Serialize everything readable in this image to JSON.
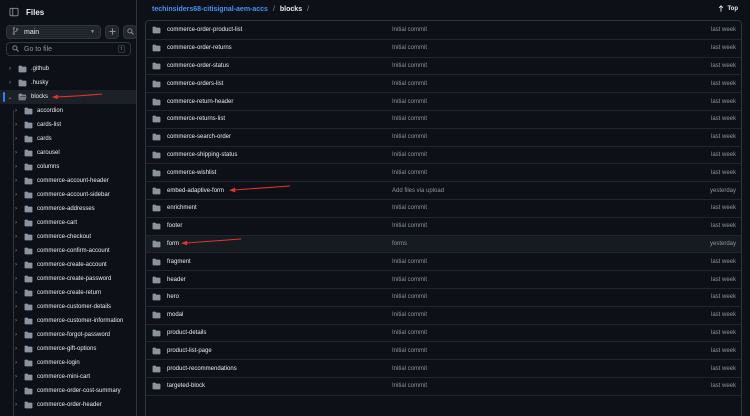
{
  "sidebar": {
    "title": "Files",
    "branch": "main",
    "goto_placeholder": "Go to file",
    "goto_shortcut": "t",
    "tree": [
      {
        "label": ".github",
        "indent": 0
      },
      {
        "label": ".husky",
        "indent": 0
      },
      {
        "label": "blocks",
        "indent": 0,
        "expanded": true,
        "selected": true
      },
      {
        "label": "accordion",
        "indent": 1
      },
      {
        "label": "cards-list",
        "indent": 1
      },
      {
        "label": "cards",
        "indent": 1
      },
      {
        "label": "carousel",
        "indent": 1
      },
      {
        "label": "columns",
        "indent": 1
      },
      {
        "label": "commerce-account-header",
        "indent": 1
      },
      {
        "label": "commerce-account-sidebar",
        "indent": 1
      },
      {
        "label": "commerce-addresses",
        "indent": 1
      },
      {
        "label": "commerce-cart",
        "indent": 1
      },
      {
        "label": "commerce-checkout",
        "indent": 1
      },
      {
        "label": "commerce-confirm-account",
        "indent": 1
      },
      {
        "label": "commerce-create-account",
        "indent": 1
      },
      {
        "label": "commerce-create-password",
        "indent": 1
      },
      {
        "label": "commerce-create-return",
        "indent": 1
      },
      {
        "label": "commerce-customer-details",
        "indent": 1
      },
      {
        "label": "commerce-customer-information",
        "indent": 1
      },
      {
        "label": "commerce-forgot-password",
        "indent": 1
      },
      {
        "label": "commerce-gift-options",
        "indent": 1
      },
      {
        "label": "commerce-login",
        "indent": 1
      },
      {
        "label": "commerce-mini-cart",
        "indent": 1
      },
      {
        "label": "commerce-order-cost-summary",
        "indent": 1
      },
      {
        "label": "commerce-order-header",
        "indent": 1
      }
    ]
  },
  "header": {
    "repo": "techinsiders68-citisignal-aem-accs",
    "separator": "/",
    "current": "blocks",
    "top_label": "Top"
  },
  "files": [
    {
      "name": "commerce-order-product-list",
      "message": "Initial commit",
      "date": "last week"
    },
    {
      "name": "commerce-order-returns",
      "message": "Initial commit",
      "date": "last week"
    },
    {
      "name": "commerce-order-status",
      "message": "Initial commit",
      "date": "last week"
    },
    {
      "name": "commerce-orders-list",
      "message": "Initial commit",
      "date": "last week"
    },
    {
      "name": "commerce-return-header",
      "message": "Initial commit",
      "date": "last week"
    },
    {
      "name": "commerce-returns-list",
      "message": "Initial commit",
      "date": "last week"
    },
    {
      "name": "commerce-search-order",
      "message": "Initial commit",
      "date": "last week"
    },
    {
      "name": "commerce-shipping-status",
      "message": "Initial commit",
      "date": "last week"
    },
    {
      "name": "commerce-wishlist",
      "message": "Initial commit",
      "date": "last week"
    },
    {
      "name": "embed-adaptive-form",
      "message": "Add files via upload",
      "date": "yesterday"
    },
    {
      "name": "enrichment",
      "message": "Initial commit",
      "date": "last week"
    },
    {
      "name": "footer",
      "message": "Initial commit",
      "date": "last week"
    },
    {
      "name": "form",
      "message": "forms",
      "date": "yesterday",
      "highlight": true
    },
    {
      "name": "fragment",
      "message": "Initial commit",
      "date": "last week"
    },
    {
      "name": "header",
      "message": "Initial commit",
      "date": "last week"
    },
    {
      "name": "hero",
      "message": "Initial commit",
      "date": "last week"
    },
    {
      "name": "modal",
      "message": "Initial commit",
      "date": "last week"
    },
    {
      "name": "product-details",
      "message": "Initial commit",
      "date": "last week"
    },
    {
      "name": "product-list-page",
      "message": "Initial commit",
      "date": "last week"
    },
    {
      "name": "product-recommendations",
      "message": "Initial commit",
      "date": "last week"
    },
    {
      "name": "targeted-block",
      "message": "Initial commit",
      "date": "last week"
    }
  ],
  "colors": {
    "background": "#0d1117",
    "border": "#30363d",
    "link": "#4493f8",
    "folder": "#8b949e",
    "annotation_arrow": "#e5332a",
    "muted_text": "#8b949e"
  }
}
